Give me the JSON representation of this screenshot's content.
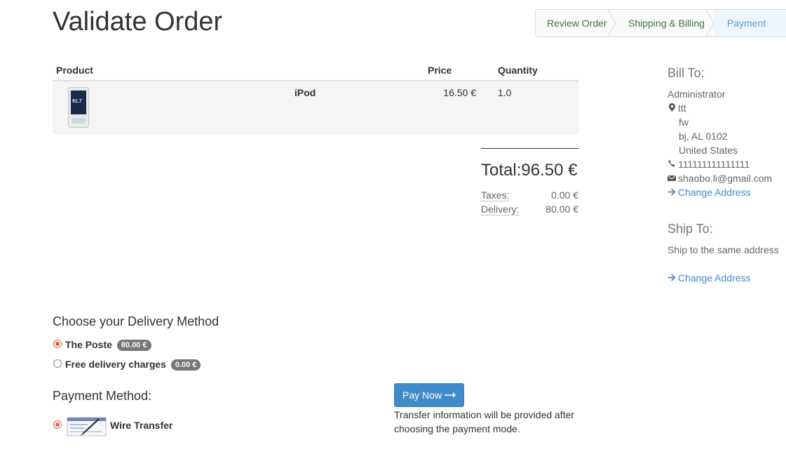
{
  "page": {
    "title": "Validate Order"
  },
  "wizard": {
    "steps": [
      "Review Order",
      "Shipping & Billing",
      "Payment"
    ]
  },
  "table": {
    "headers": {
      "product": "Product",
      "price": "Price",
      "quantity": "Quantity"
    },
    "rows": [
      {
        "name": "iPod",
        "price": "16.50 €",
        "quantity": "1.0",
        "image_text": "91.7"
      }
    ]
  },
  "totals": {
    "total_label": "Total:",
    "total_value": "96.50 €",
    "taxes_label": "Taxes:",
    "taxes_value": "0.00 €",
    "delivery_label": "Delivery:",
    "delivery_value": "80.00 €"
  },
  "bill_to": {
    "heading": "Bill To:",
    "name": "Administrator",
    "address_lines": [
      "ttt",
      "fw",
      "bj, AL 0102",
      "United States"
    ],
    "phone": "111111111111111",
    "email": "shaobo.li@gmail.com",
    "change_link": "Change Address"
  },
  "ship_to": {
    "heading": "Ship To:",
    "text": "Ship to the same address",
    "change_link": "Change Address"
  },
  "delivery": {
    "heading": "Choose your Delivery Method",
    "options": [
      {
        "label": "The Poste",
        "price": "80.00 €",
        "selected": true
      },
      {
        "label": "Free delivery charges",
        "price": "0.00 €",
        "selected": false
      }
    ]
  },
  "payment": {
    "heading": "Payment Method:",
    "method": "Wire Transfer",
    "button": "Pay Now",
    "note": "Transfer information will be provided after choosing the payment mode."
  },
  "colors": {
    "link": "#428bca",
    "wizard_done": "#3c763d",
    "radio_selected": "#d9653a",
    "badge": "#777777"
  },
  "icons": [
    "map-marker-icon",
    "phone-icon",
    "envelope-icon",
    "arrow-right-icon"
  ]
}
